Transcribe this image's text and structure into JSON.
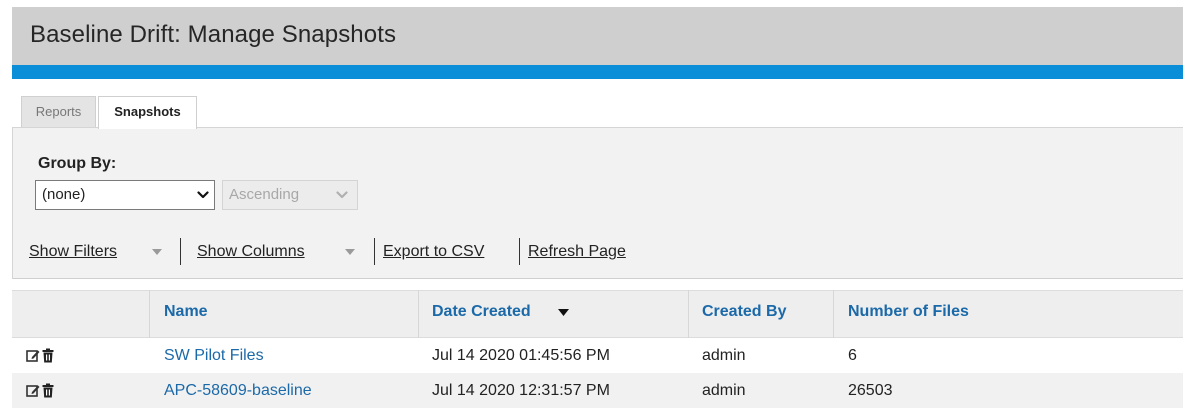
{
  "header": {
    "title": "Baseline Drift: Manage Snapshots",
    "accent_color": "#0a8ed8"
  },
  "tabs": [
    {
      "label": "Reports",
      "active": false
    },
    {
      "label": "Snapshots",
      "active": true
    }
  ],
  "group_by": {
    "label": "Group By:",
    "field_value": "(none)",
    "order_value": "Ascending",
    "order_disabled": true
  },
  "actions": {
    "show_filters": "Show Filters",
    "show_columns": "Show Columns",
    "export_csv": "Export to CSV",
    "refresh": "Refresh Page"
  },
  "table": {
    "columns": [
      "Name",
      "Date Created",
      "Created By",
      "Number of Files"
    ],
    "sort_column": "Date Created",
    "rows": [
      {
        "name": "SW Pilot Files",
        "date_created": "Jul 14 2020 01:45:56 PM",
        "created_by": "admin",
        "number_of_files": "6"
      },
      {
        "name": "APC-58609-baseline",
        "date_created": "Jul 14 2020 12:31:57 PM",
        "created_by": "admin",
        "number_of_files": "26503"
      }
    ],
    "row_icons": [
      "edit-icon",
      "trash-icon"
    ]
  }
}
